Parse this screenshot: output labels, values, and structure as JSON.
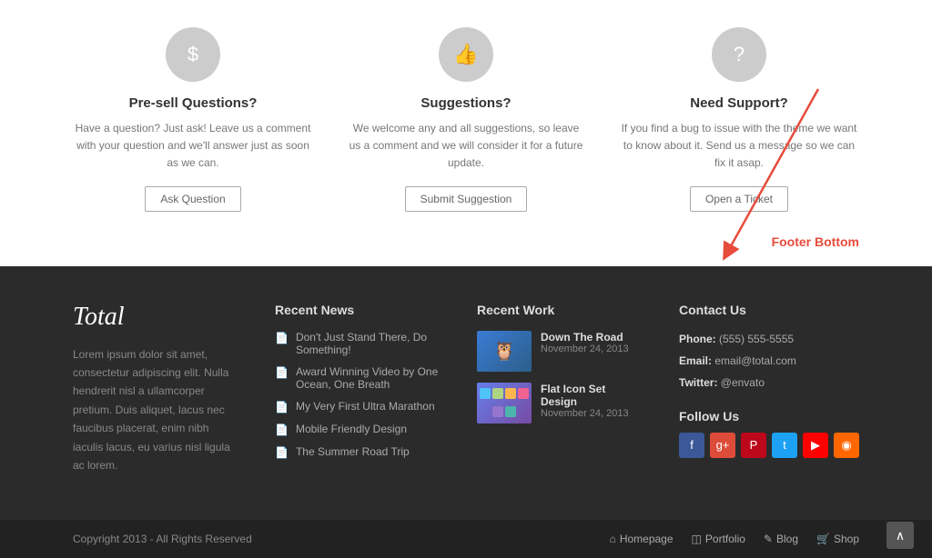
{
  "top": {
    "presell": {
      "icon": "$",
      "title": "Pre-sell Questions?",
      "desc": "Have a question? Just ask! Leave us a comment with your question and we'll answer just as soon as we can.",
      "btn": "Ask Question"
    },
    "suggestions": {
      "icon": "👍",
      "title": "Suggestions?",
      "desc": "We welcome any and all suggestions, so leave us a comment and we will consider it for a future update.",
      "btn": "Submit Suggestion"
    },
    "support": {
      "icon": "?",
      "title": "Need Support?",
      "desc": "If you find a bug to issue with the theme we want to know about it. Send us a message so we can fix it asap.",
      "btn": "Open a Ticket"
    }
  },
  "annotation": {
    "label": "Footer Bottom"
  },
  "footer": {
    "logo": "Total",
    "about_text": "Lorem ipsum dolor sit amet, consectetur adipiscing elit. Nulla hendrerit nisl a ullamcorper pretium. Duis aliquet, lacus nec faucibus placerat, enim nibh iaculis lacus, eu varius nisl ligula ac lorem.",
    "recent_news": {
      "title": "Recent News",
      "items": [
        "Don't Just Stand There, Do Something!",
        "Award Winning Video by One Ocean, One Breath",
        "My Very First Ultra Marathon",
        "Mobile Friendly Design",
        "The Summer Road Trip"
      ]
    },
    "recent_work": {
      "title": "Recent Work",
      "items": [
        {
          "title": "Down The Road",
          "date": "November 24, 2013",
          "thumb_type": "bird"
        },
        {
          "title": "Flat Icon Set Design",
          "date": "November 24, 2013",
          "thumb_type": "icons"
        }
      ]
    },
    "contact": {
      "title": "Contact Us",
      "phone_label": "Phone:",
      "phone": "(555) 555-5555",
      "email_label": "Email:",
      "email": "email@total.com",
      "twitter_label": "Twitter:",
      "twitter": "@envato"
    },
    "follow": {
      "title": "Follow Us",
      "networks": [
        "fb",
        "gp",
        "pi",
        "tw",
        "yt",
        "rss"
      ]
    }
  },
  "footer_bottom": {
    "copyright": "Copyright 2013 - All Rights Reserved",
    "nav": [
      {
        "icon": "⌂",
        "label": "Homepage"
      },
      {
        "icon": "◫",
        "label": "Portfolio"
      },
      {
        "icon": "✎",
        "label": "Blog"
      },
      {
        "icon": "🛒",
        "label": "Shop"
      }
    ]
  }
}
